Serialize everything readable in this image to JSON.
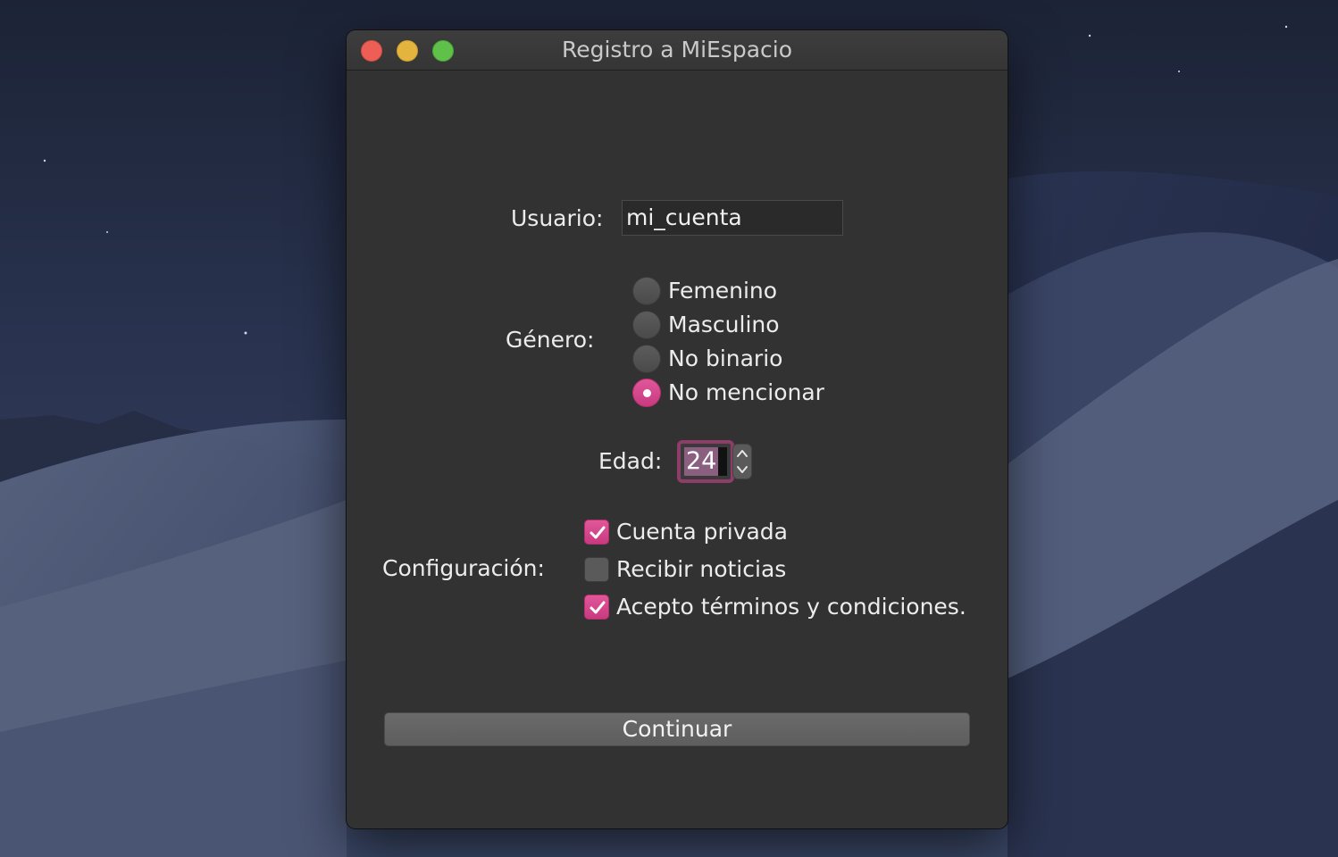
{
  "window": {
    "title": "Registro a MiEspacio"
  },
  "form": {
    "user_label": "Usuario:",
    "user_value": "mi_cuenta",
    "gender_label": "Género:",
    "gender_options": [
      "Femenino",
      "Masculino",
      "No binario",
      "No mencionar"
    ],
    "gender_selected": "No mencionar",
    "age_label": "Edad:",
    "age_value": "24",
    "config_label": "Configuración:",
    "config_options": [
      {
        "label": "Cuenta privada",
        "checked": true
      },
      {
        "label": "Recibir noticias",
        "checked": false
      },
      {
        "label": "Acepto términos y condiciones.",
        "checked": true
      }
    ],
    "continue_label": "Continuar"
  },
  "colors": {
    "accent": "#d8468b",
    "window_bg": "#323232",
    "titlebar": "#3a3a3a",
    "close": "#ed5f56",
    "minimize": "#e3b43e",
    "maximize": "#5fc04a"
  },
  "icons": {
    "check": "checkmark-icon",
    "stepper_up": "chevron-up-icon",
    "stepper_down": "chevron-down-icon"
  }
}
